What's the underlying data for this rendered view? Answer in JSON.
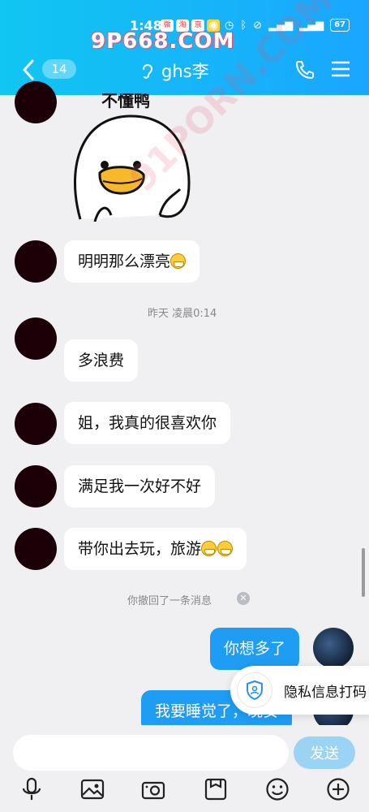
{
  "status": {
    "time": "1:48",
    "battery": "67",
    "apps": [
      "微",
      "淘",
      "京",
      "✓"
    ]
  },
  "watermark": {
    "top": "9P668.COM",
    "diagonal": "91PORN.COM"
  },
  "header": {
    "unread_count": "14",
    "title": "ghs李"
  },
  "sticker": {
    "caption": "不懂鸭"
  },
  "messages": [
    {
      "side": "left",
      "text": "明明那么漂亮",
      "emoji": 1
    },
    {
      "side": "left",
      "text": "多浪费"
    },
    {
      "side": "left",
      "text": "姐，我真的很喜欢你"
    },
    {
      "side": "left",
      "text": "满足我一次好不好"
    },
    {
      "side": "left",
      "text": "带你出去玩，旅游",
      "emoji": 2
    },
    {
      "side": "right",
      "text": "你想多了"
    },
    {
      "side": "right",
      "text": "我要睡觉了，晚安"
    }
  ],
  "system": {
    "timestamp": "昨天 凌晨0:14",
    "recalled": "你撤回了一条消息"
  },
  "privacy_button": {
    "label": "隐私信息打码"
  },
  "input": {
    "placeholder": "",
    "send_label": "发送"
  },
  "toolbar_icons": [
    "microphone-icon",
    "image-icon",
    "camera-icon",
    "file-icon",
    "emoji-icon",
    "plus-icon"
  ]
}
